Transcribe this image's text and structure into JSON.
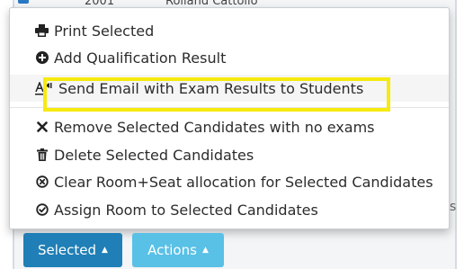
{
  "background": {
    "row_cells": [
      "2001",
      "Rolland Cattolio"
    ],
    "stray_marks": [
      "s"
    ]
  },
  "menu": {
    "items": [
      {
        "label": "Print Selected",
        "icon": "printer-icon"
      },
      {
        "label": "Add Qualification Result",
        "icon": "plus-circle-icon"
      },
      {
        "label": "Send Email with Exam Results to Students",
        "icon": "text-send-icon",
        "highlighted": true
      },
      {
        "label": "Remove Selected Candidates with no exams",
        "icon": "x-icon"
      },
      {
        "label": "Delete Selected Candidates",
        "icon": "trash-icon"
      },
      {
        "label": "Clear Room+Seat allocation for Selected Candidates",
        "icon": "x-circle-icon"
      },
      {
        "label": "Assign Room to Selected Candidates",
        "icon": "check-circle-icon"
      }
    ],
    "highlight_color": "#f6ea0e"
  },
  "buttons": {
    "selected_label": "Selected",
    "actions_label": "Actions",
    "caret": "▲",
    "selected_color": "#1f7fb6",
    "actions_color": "#59c0e6"
  }
}
